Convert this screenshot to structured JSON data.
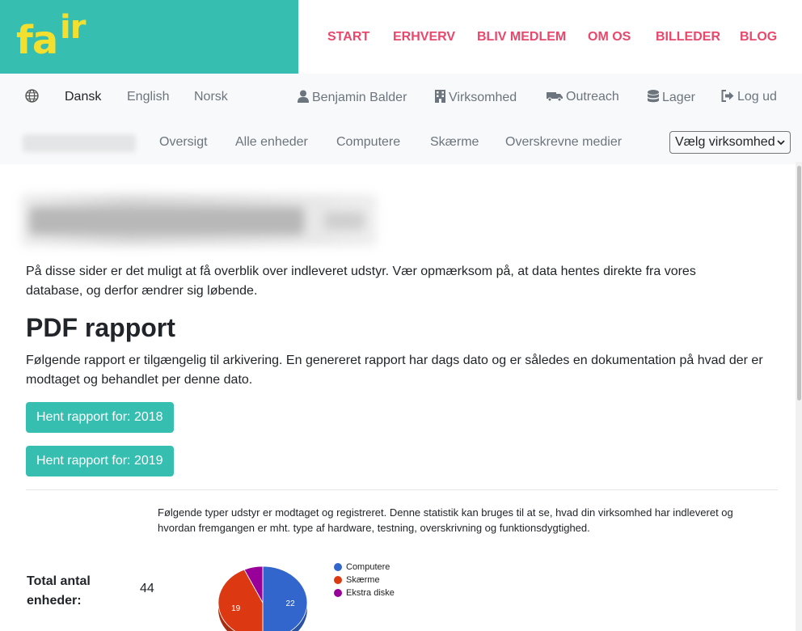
{
  "logo": {
    "part1": "fa",
    "part2": "ir"
  },
  "colors": {
    "brand_teal": "#36bfb0",
    "logo_yellow": "#f2df2f",
    "nav_pink": "#e8486c",
    "computere": "#3366cc",
    "skaerme": "#dc3912",
    "ekstra_diske": "#990099"
  },
  "main_nav": [
    "START",
    "ERHVERV",
    "BLIV MEDLEM",
    "OM OS",
    "BILLEDER",
    "BLOG"
  ],
  "languages": {
    "icon": "globe-icon",
    "items": [
      "Dansk",
      "English",
      "Norsk"
    ],
    "active": "Dansk"
  },
  "user_nav": [
    {
      "label": "Benjamin Balder",
      "icon": "user-icon"
    },
    {
      "label": "Virksomhed",
      "icon": "building-icon"
    },
    {
      "label": "Outreach",
      "icon": "truck-icon"
    },
    {
      "label": "Lager",
      "icon": "database-icon"
    },
    {
      "label": "Log ud",
      "icon": "sign-out-icon"
    }
  ],
  "sub_nav": [
    "Oversigt",
    "Alle enheder",
    "Computere",
    "Skærme",
    "Overskrevne medier"
  ],
  "company_select": {
    "value": "Vælg virksomhed"
  },
  "intro": "På disse sider er det muligt at få overblik over indleveret udstyr. Vær opmærksom på, at data hentes direkte fra vores database, og derfor ændrer sig løbende.",
  "pdf": {
    "heading": "PDF rapport",
    "text": "Følgende rapport er tilgængelig til arkivering. En genereret rapport har dags dato og er således en dokumentation på hvad der er modtaget og behandlet per denne dato.",
    "buttons": [
      "Hent rapport for: 2018",
      "Hent rapport for: 2019"
    ]
  },
  "stats": {
    "description": "Følgende typer udstyr er modtaget og registreret. Denne statistik kan bruges til at se, hvad din virksomhed har indleveret og hvordan fremgangen er mht. type af hardware, testning, overskrivning og funktionsdygtighed.",
    "total_label": "Total antal enheder:",
    "total_value": "44"
  },
  "chart_data": {
    "type": "pie",
    "categories": [
      "Computere",
      "Skærme",
      "Ekstra diske"
    ],
    "values": [
      22,
      19,
      3
    ],
    "labels": [
      "22",
      "19",
      ""
    ],
    "legend": "right"
  }
}
